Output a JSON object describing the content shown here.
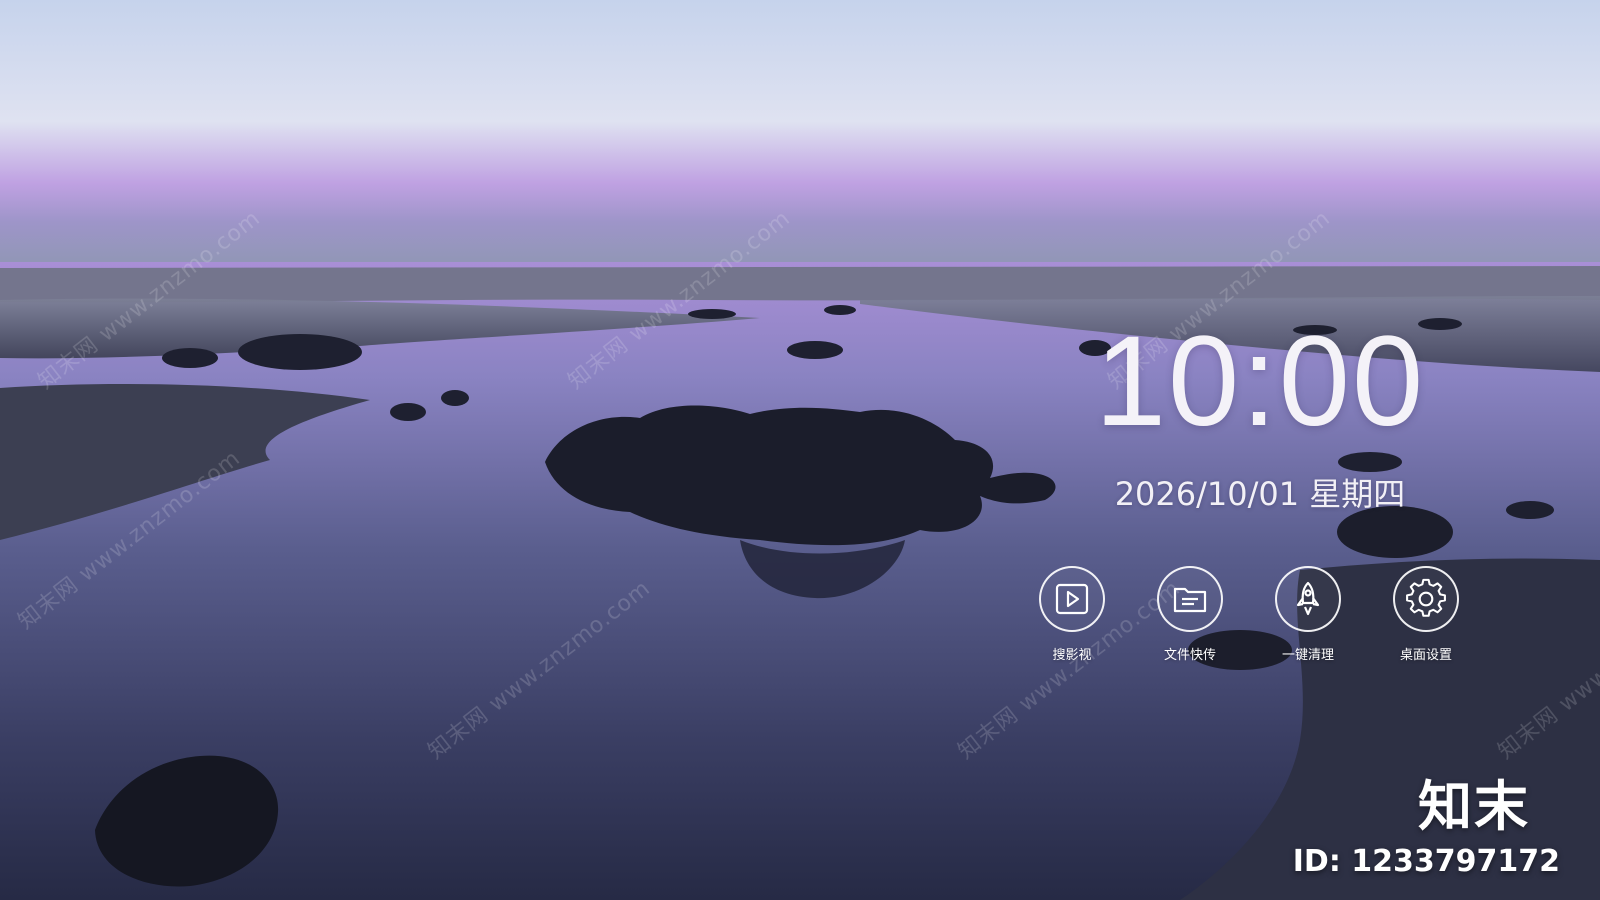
{
  "clock": {
    "time": "10:00",
    "date": "2026/10/01 星期四"
  },
  "apps": [
    {
      "label": "搜影视",
      "icon": "play-video-icon"
    },
    {
      "label": "文件快传",
      "icon": "folder-file-icon"
    },
    {
      "label": "一键清理",
      "icon": "rocket-icon"
    },
    {
      "label": "桌面设置",
      "icon": "gear-icon"
    }
  ],
  "watermark": {
    "text": "知末网 www.znzmo.com"
  },
  "brand": {
    "logo": "知末",
    "image_id": "ID: 1233797172"
  },
  "colors": {
    "icon_stroke": "#ffffff",
    "sky_top": "#c9d5ec",
    "sky_glow": "#b58fe0",
    "water": "#3a3e63"
  }
}
